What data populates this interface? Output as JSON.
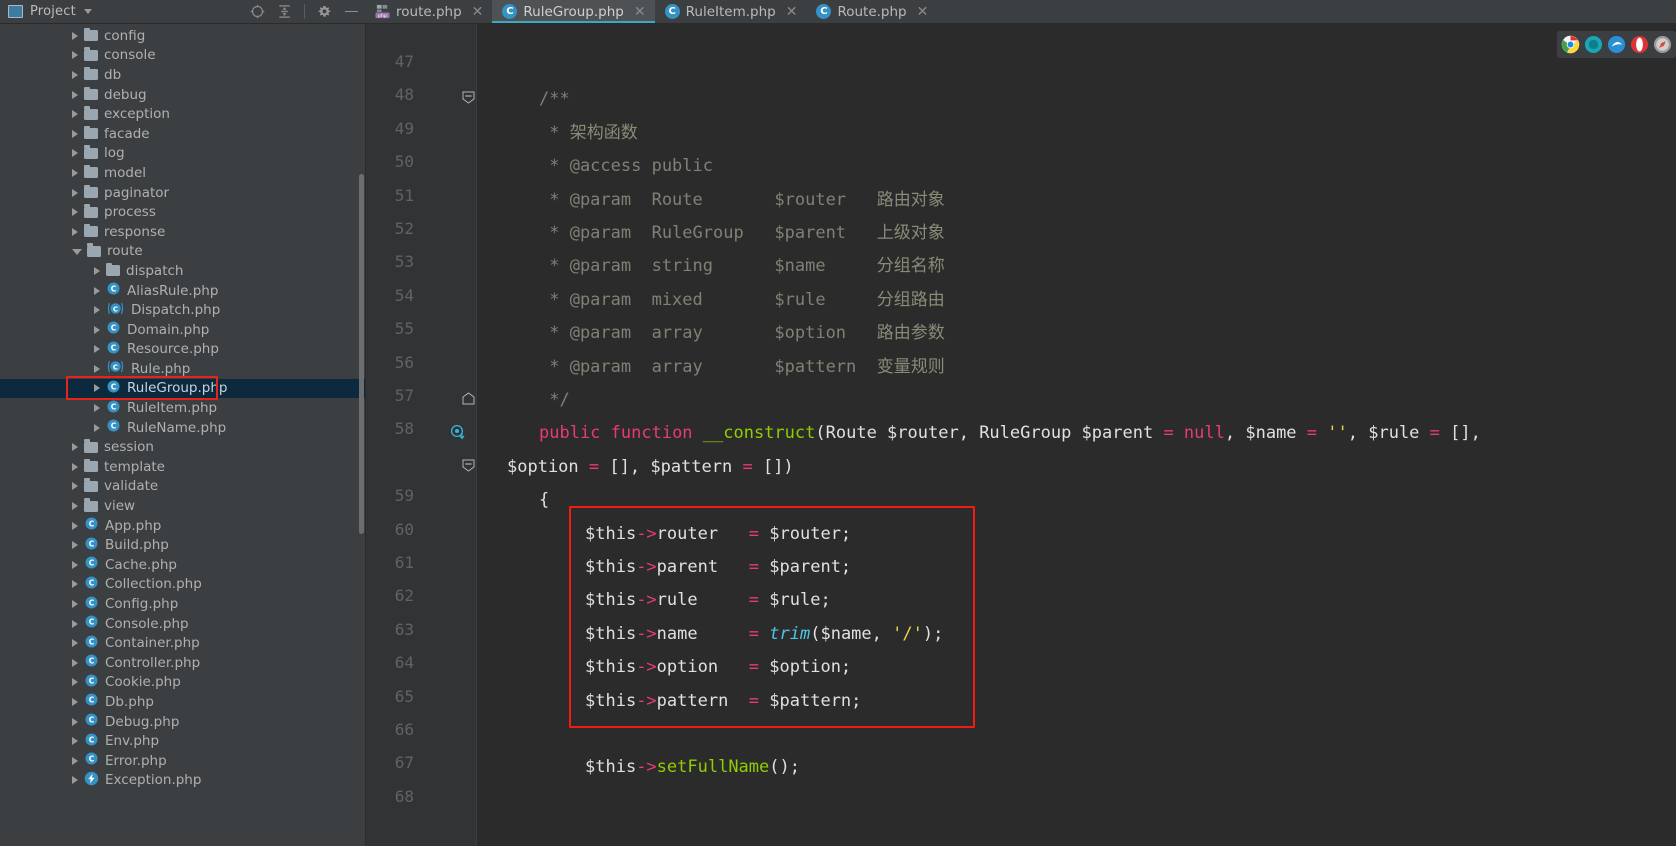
{
  "window": {
    "project_panel_title": "Project",
    "project_panel_icon": "project-window-icon",
    "chevron_icon": "chevron-down-icon",
    "toolbar_icons": [
      {
        "name": "locate-target-icon",
        "glyph": "target"
      },
      {
        "name": "collapse-all-icon",
        "glyph": "collapse"
      },
      {
        "name": "settings-gear-icon",
        "glyph": "gear"
      },
      {
        "name": "hide-panel-icon",
        "glyph": "minus"
      }
    ]
  },
  "tabs": [
    {
      "label": "route.php",
      "icon": "php-file-icon",
      "active": false,
      "close_icon": "close-icon"
    },
    {
      "label": "RuleGroup.php",
      "icon": "php-class-icon",
      "active": true,
      "close_icon": "close-icon"
    },
    {
      "label": "RuleItem.php",
      "icon": "php-class-icon",
      "active": false,
      "close_icon": "close-icon"
    },
    {
      "label": "Route.php",
      "icon": "php-class-icon",
      "active": false,
      "close_icon": "close-icon"
    }
  ],
  "sidebar": {
    "scrollbar": "vertical-scrollbar",
    "items": [
      {
        "label": "config",
        "type": "folder",
        "indent": 1,
        "expanded": false
      },
      {
        "label": "console",
        "type": "folder",
        "indent": 1,
        "expanded": false
      },
      {
        "label": "db",
        "type": "folder",
        "indent": 1,
        "expanded": false
      },
      {
        "label": "debug",
        "type": "folder",
        "indent": 1,
        "expanded": false
      },
      {
        "label": "exception",
        "type": "folder",
        "indent": 1,
        "expanded": false
      },
      {
        "label": "facade",
        "type": "folder",
        "indent": 1,
        "expanded": false
      },
      {
        "label": "log",
        "type": "folder",
        "indent": 1,
        "expanded": false
      },
      {
        "label": "model",
        "type": "folder",
        "indent": 1,
        "expanded": false
      },
      {
        "label": "paginator",
        "type": "folder",
        "indent": 1,
        "expanded": false
      },
      {
        "label": "process",
        "type": "folder",
        "indent": 1,
        "expanded": false
      },
      {
        "label": "response",
        "type": "folder",
        "indent": 1,
        "expanded": false
      },
      {
        "label": "route",
        "type": "folder",
        "indent": 1,
        "expanded": true
      },
      {
        "label": "dispatch",
        "type": "folder",
        "indent": 2,
        "expanded": false
      },
      {
        "label": "AliasRule.php",
        "type": "class",
        "indent": 2,
        "expanded": false
      },
      {
        "label": "Dispatch.php",
        "type": "abstract",
        "indent": 2,
        "expanded": false
      },
      {
        "label": "Domain.php",
        "type": "class",
        "indent": 2,
        "expanded": false
      },
      {
        "label": "Resource.php",
        "type": "class",
        "indent": 2,
        "expanded": false
      },
      {
        "label": "Rule.php",
        "type": "abstract",
        "indent": 2,
        "expanded": false
      },
      {
        "label": "RuleGroup.php",
        "type": "class",
        "indent": 2,
        "expanded": false,
        "selected": true,
        "highlighted": true
      },
      {
        "label": "RuleItem.php",
        "type": "class",
        "indent": 2,
        "expanded": false
      },
      {
        "label": "RuleName.php",
        "type": "class",
        "indent": 2,
        "expanded": false
      },
      {
        "label": "session",
        "type": "folder",
        "indent": 1,
        "expanded": false
      },
      {
        "label": "template",
        "type": "folder",
        "indent": 1,
        "expanded": false
      },
      {
        "label": "validate",
        "type": "folder",
        "indent": 1,
        "expanded": false
      },
      {
        "label": "view",
        "type": "folder",
        "indent": 1,
        "expanded": false
      },
      {
        "label": "App.php",
        "type": "class",
        "indent": 1,
        "expanded": false
      },
      {
        "label": "Build.php",
        "type": "class",
        "indent": 1,
        "expanded": false
      },
      {
        "label": "Cache.php",
        "type": "class",
        "indent": 1,
        "expanded": false
      },
      {
        "label": "Collection.php",
        "type": "class",
        "indent": 1,
        "expanded": false
      },
      {
        "label": "Config.php",
        "type": "class",
        "indent": 1,
        "expanded": false
      },
      {
        "label": "Console.php",
        "type": "class",
        "indent": 1,
        "expanded": false
      },
      {
        "label": "Container.php",
        "type": "class",
        "indent": 1,
        "expanded": false
      },
      {
        "label": "Controller.php",
        "type": "class",
        "indent": 1,
        "expanded": false
      },
      {
        "label": "Cookie.php",
        "type": "class",
        "indent": 1,
        "expanded": false
      },
      {
        "label": "Db.php",
        "type": "class",
        "indent": 1,
        "expanded": false
      },
      {
        "label": "Debug.php",
        "type": "class",
        "indent": 1,
        "expanded": false
      },
      {
        "label": "Env.php",
        "type": "class",
        "indent": 1,
        "expanded": false
      },
      {
        "label": "Error.php",
        "type": "class",
        "indent": 1,
        "expanded": false
      },
      {
        "label": "Exception.php",
        "type": "exception",
        "indent": 1,
        "expanded": false
      }
    ]
  },
  "editor": {
    "file": "RuleGroup.php",
    "line_numbers": [
      "47",
      "48",
      "49",
      "50",
      "51",
      "52",
      "53",
      "54",
      "55",
      "56",
      "57",
      "58",
      "59",
      "60",
      "61",
      "62",
      "63",
      "64",
      "65",
      "66",
      "67",
      "68"
    ],
    "gutter_markers": [
      {
        "line": "48",
        "name": "fold-collapse-icon"
      },
      {
        "line": "57",
        "name": "fold-end-icon"
      },
      {
        "line": "58",
        "name": "override-method-icon"
      },
      {
        "line": "58b",
        "name": "fold-collapse-icon"
      }
    ],
    "lines": [
      {
        "num": "47",
        "tokens": []
      },
      {
        "num": "48",
        "tokens": [
          {
            "t": "/**",
            "c": "cmt"
          }
        ]
      },
      {
        "num": "49",
        "tokens": [
          {
            "t": " * ",
            "c": "cmt"
          },
          {
            "t": "架构函数",
            "c": "cmt-cn"
          }
        ]
      },
      {
        "num": "50",
        "tokens": [
          {
            "t": " * @access public",
            "c": "cmt"
          }
        ]
      },
      {
        "num": "51",
        "tokens": [
          {
            "t": " * @param  Route       $router   ",
            "c": "cmt"
          },
          {
            "t": "路由对象",
            "c": "cmt-cn"
          }
        ]
      },
      {
        "num": "52",
        "tokens": [
          {
            "t": " * @param  RuleGroup   $parent   ",
            "c": "cmt"
          },
          {
            "t": "上级对象",
            "c": "cmt-cn"
          }
        ]
      },
      {
        "num": "53",
        "tokens": [
          {
            "t": " * @param  string      $name     ",
            "c": "cmt"
          },
          {
            "t": "分组名称",
            "c": "cmt-cn"
          }
        ]
      },
      {
        "num": "54",
        "tokens": [
          {
            "t": " * @param  mixed       $rule     ",
            "c": "cmt"
          },
          {
            "t": "分组路由",
            "c": "cmt-cn"
          }
        ]
      },
      {
        "num": "55",
        "tokens": [
          {
            "t": " * @param  array       $option   ",
            "c": "cmt"
          },
          {
            "t": "路由参数",
            "c": "cmt-cn"
          }
        ]
      },
      {
        "num": "56",
        "tokens": [
          {
            "t": " * @param  array       $pattern  ",
            "c": "cmt"
          },
          {
            "t": "变量规则",
            "c": "cmt-cn"
          }
        ]
      },
      {
        "num": "57",
        "tokens": [
          {
            "t": " */",
            "c": "cmt"
          }
        ]
      },
      {
        "num": "58",
        "tokens": [
          {
            "t": "public ",
            "c": "kw"
          },
          {
            "t": "function ",
            "c": "kw"
          },
          {
            "t": "__construct",
            "c": "fn"
          },
          {
            "t": "(",
            "c": "plain"
          },
          {
            "t": "Route ",
            "c": "plain"
          },
          {
            "t": "$router",
            "c": "plain"
          },
          {
            "t": ", ",
            "c": "plain"
          },
          {
            "t": "RuleGroup ",
            "c": "plain"
          },
          {
            "t": "$parent ",
            "c": "plain"
          },
          {
            "t": "= ",
            "c": "op"
          },
          {
            "t": "null",
            "c": "nul"
          },
          {
            "t": ", ",
            "c": "plain"
          },
          {
            "t": "$name ",
            "c": "plain"
          },
          {
            "t": "= ",
            "c": "op"
          },
          {
            "t": "''",
            "c": "str"
          },
          {
            "t": ", ",
            "c": "plain"
          },
          {
            "t": "$rule ",
            "c": "plain"
          },
          {
            "t": "= ",
            "c": "op"
          },
          {
            "t": "[]",
            "c": "plain"
          },
          {
            "t": ",",
            "c": "plain"
          }
        ]
      },
      {
        "num": "58w",
        "tokens": [
          {
            "t": "$option ",
            "c": "plain"
          },
          {
            "t": "= ",
            "c": "op"
          },
          {
            "t": "[]",
            "c": "plain"
          },
          {
            "t": ", ",
            "c": "plain"
          },
          {
            "t": "$pattern ",
            "c": "plain"
          },
          {
            "t": "= ",
            "c": "op"
          },
          {
            "t": "[])",
            "c": "plain"
          }
        ]
      },
      {
        "num": "59",
        "tokens": [
          {
            "t": "{",
            "c": "plain"
          }
        ]
      },
      {
        "num": "60",
        "tokens": [
          {
            "t": "$this",
            "c": "plain"
          },
          {
            "t": "->",
            "c": "arrow-op"
          },
          {
            "t": "router   ",
            "c": "plain"
          },
          {
            "t": "= ",
            "c": "op"
          },
          {
            "t": "$router;",
            "c": "plain"
          }
        ]
      },
      {
        "num": "61",
        "tokens": [
          {
            "t": "$this",
            "c": "plain"
          },
          {
            "t": "->",
            "c": "arrow-op"
          },
          {
            "t": "parent   ",
            "c": "plain"
          },
          {
            "t": "= ",
            "c": "op"
          },
          {
            "t": "$parent;",
            "c": "plain"
          }
        ]
      },
      {
        "num": "62",
        "tokens": [
          {
            "t": "$this",
            "c": "plain"
          },
          {
            "t": "->",
            "c": "arrow-op"
          },
          {
            "t": "rule     ",
            "c": "plain"
          },
          {
            "t": "= ",
            "c": "op"
          },
          {
            "t": "$rule;",
            "c": "plain"
          }
        ]
      },
      {
        "num": "63",
        "tokens": [
          {
            "t": "$this",
            "c": "plain"
          },
          {
            "t": "->",
            "c": "arrow-op"
          },
          {
            "t": "name     ",
            "c": "plain"
          },
          {
            "t": "= ",
            "c": "op"
          },
          {
            "t": "trim",
            "c": "builtin"
          },
          {
            "t": "($name, ",
            "c": "plain"
          },
          {
            "t": "'/'",
            "c": "str"
          },
          {
            "t": ");",
            "c": "plain"
          }
        ]
      },
      {
        "num": "64",
        "tokens": [
          {
            "t": "$this",
            "c": "plain"
          },
          {
            "t": "->",
            "c": "arrow-op"
          },
          {
            "t": "option   ",
            "c": "plain"
          },
          {
            "t": "= ",
            "c": "op"
          },
          {
            "t": "$option;",
            "c": "plain"
          }
        ]
      },
      {
        "num": "65",
        "tokens": [
          {
            "t": "$this",
            "c": "plain"
          },
          {
            "t": "->",
            "c": "arrow-op"
          },
          {
            "t": "pattern  ",
            "c": "plain"
          },
          {
            "t": "= ",
            "c": "op"
          },
          {
            "t": "$pattern;",
            "c": "plain"
          }
        ]
      },
      {
        "num": "66",
        "tokens": []
      },
      {
        "num": "67",
        "tokens": [
          {
            "t": "$this",
            "c": "plain"
          },
          {
            "t": "->",
            "c": "arrow-op"
          },
          {
            "t": "setFullName",
            "c": "fn"
          },
          {
            "t": "();",
            "c": "plain"
          }
        ]
      },
      {
        "num": "68",
        "tokens": []
      }
    ],
    "highlight_box_label": "red-annotation-rectangle"
  },
  "browser_launchers": [
    {
      "name": "chrome-icon",
      "color": "#4caf50"
    },
    {
      "name": "firefox-icon",
      "color": "#1aa7b5"
    },
    {
      "name": "edge-icon",
      "color": "#2a8fd4"
    },
    {
      "name": "opera-icon",
      "color": "#d33"
    },
    {
      "name": "safari-icon",
      "color": "#b0b0b0"
    }
  ],
  "colors": {
    "accent": "#3ba9c6",
    "annotation": "#f21b0f",
    "selection": "#0d293e",
    "editor_bg": "#2b2b2b",
    "panel_bg": "#3c3f41"
  }
}
